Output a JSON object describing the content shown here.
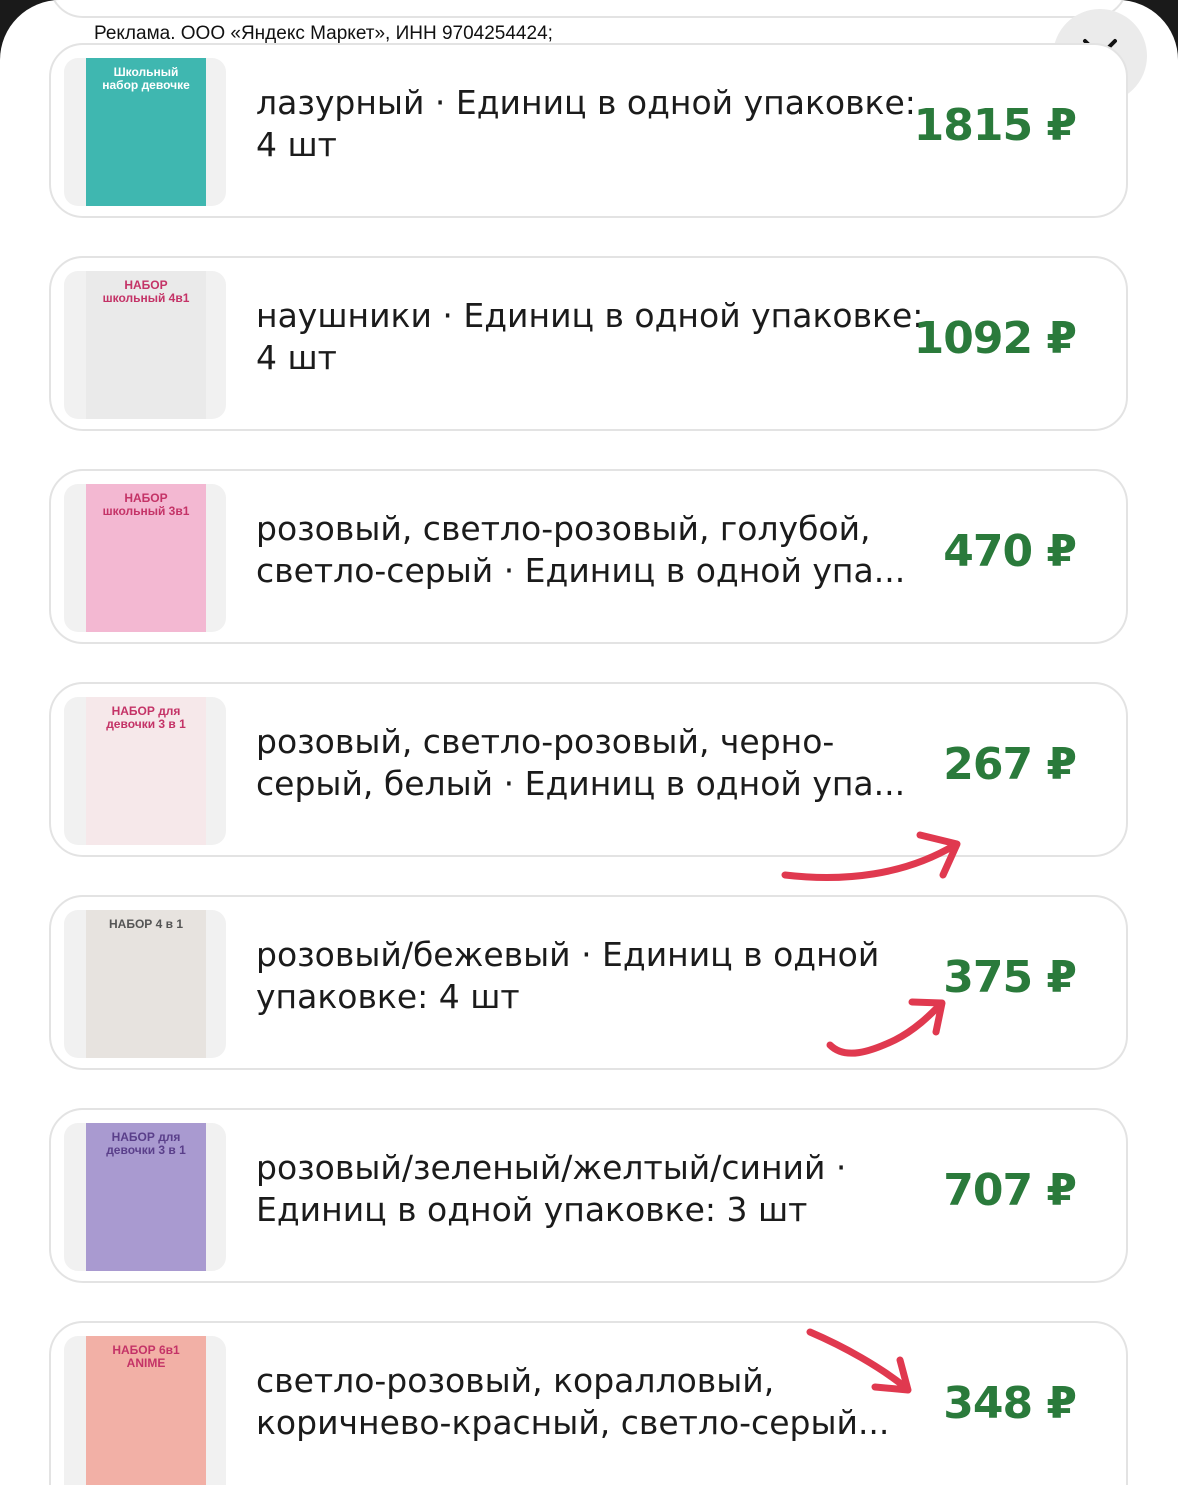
{
  "ad": {
    "label": "Реклама. ООО «Яндекс Маркет», ИНН 9704254424;"
  },
  "close": {
    "icon": "close-icon"
  },
  "colors": {
    "price": "#2a7a3b",
    "arrow": "#e0394f"
  },
  "items": [
    {
      "desc": "лазурный · Единиц в одной упаковке: 4 шт",
      "price": "1815 ₽",
      "thumb_text": "Школьный набор девочке",
      "thumb_bg": "#3fb7b0"
    },
    {
      "desc": "наушники · Единиц в одной упаковке: 4 шт",
      "price": "1092 ₽",
      "thumb_text": "НАБОР школьный 4в1",
      "thumb_bg": "#eaeaea"
    },
    {
      "desc": "розовый, светло-розовый, голубой, светло-серый · Единиц в одной упа...",
      "price": "470 ₽",
      "thumb_text": "НАБОР школьный 3в1",
      "thumb_bg": "#f3b8d2"
    },
    {
      "desc": "розовый, светло-розовый, черно-серый, белый · Единиц в одной упа...",
      "price": "267 ₽",
      "thumb_text": "НАБОР для девочки 3 в 1",
      "thumb_bg": "#f6e8ea"
    },
    {
      "desc": "розовый/бежевый · Единиц в одной упаковке: 4 шт",
      "price": "375 ₽",
      "thumb_text": "НАБОР 4 в 1",
      "thumb_bg": "#e7e3df"
    },
    {
      "desc": "розовый/зеленый/желтый/синий · Единиц в одной упаковке: 3 шт",
      "price": "707 ₽",
      "thumb_text": "НАБОР для девочки 3 в 1",
      "thumb_bg": "#a99ad0"
    },
    {
      "desc": "светло-розовый, коралловый, коричнево-красный, светло-серый...",
      "price": "348 ₽",
      "thumb_text": "НАБОР 6в1 ANIME",
      "thumb_bg": "#f2b0a6"
    }
  ]
}
